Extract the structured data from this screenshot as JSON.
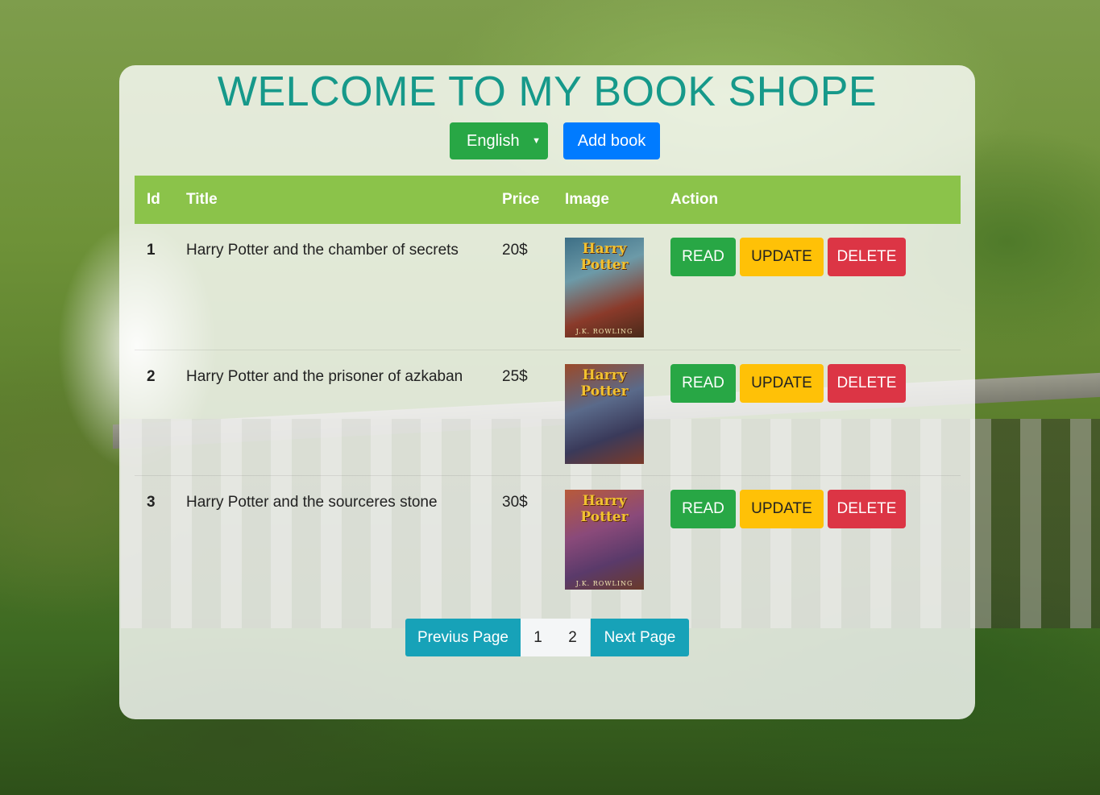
{
  "page": {
    "title": "WELCOME TO MY BOOK SHOPE"
  },
  "controls": {
    "language_selected": "English",
    "add_book_label": "Add book"
  },
  "table": {
    "headers": [
      "Id",
      "Title",
      "Price",
      "Image",
      "Action"
    ],
    "rows": [
      {
        "id": "1",
        "title": "Harry Potter and the chamber of secrets",
        "price": "20$",
        "cover_title": "Harry Potter",
        "cover_author": "J.K. ROWLING",
        "cover_color": "#5b8a9a"
      },
      {
        "id": "2",
        "title": "Harry Potter and the prisoner of azkaban",
        "price": "25$",
        "cover_title": "Harry Potter",
        "cover_author": "",
        "cover_color": "#7a3a2a"
      },
      {
        "id": "3",
        "title": "Harry Potter and the sourceres stone",
        "price": "30$",
        "cover_title": "Harry Potter",
        "cover_author": "J.K. ROWLING",
        "cover_color": "#8a3a6a"
      }
    ],
    "actions": {
      "read": "READ",
      "update": "UPDATE",
      "delete": "DELETE"
    }
  },
  "pagination": {
    "prev_label": "Previus Page",
    "pages": [
      "1",
      "2"
    ],
    "next_label": "Next Page"
  },
  "colors": {
    "title": "#16998a",
    "header_bg": "#8bc34a",
    "read": "#28a745",
    "update": "#ffc107",
    "delete": "#dc3545",
    "add_book": "#007bff",
    "pagination": "#17a2b8"
  }
}
